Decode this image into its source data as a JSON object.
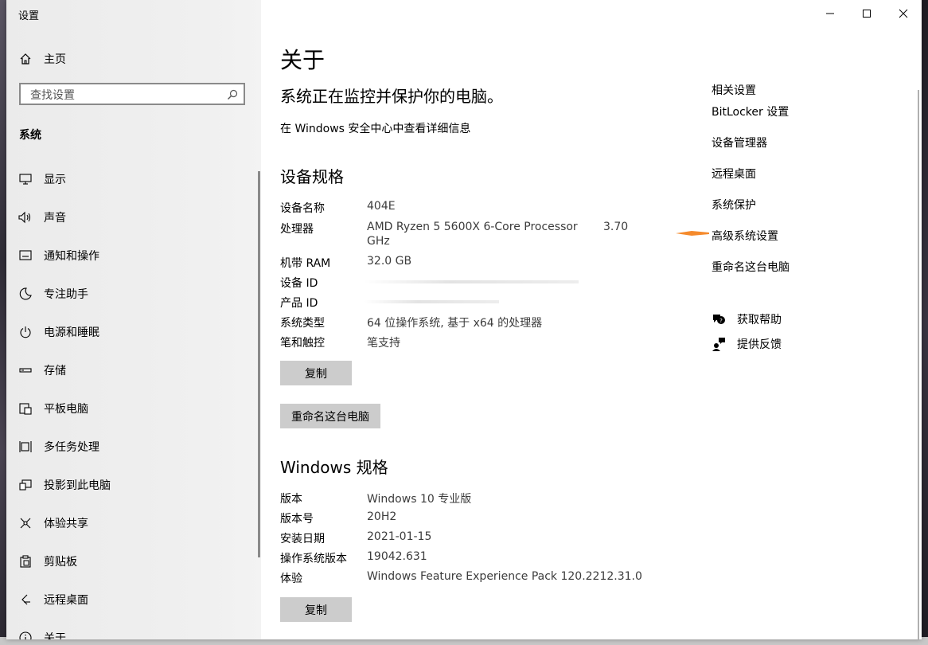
{
  "window": {
    "title": "设置"
  },
  "sidebar": {
    "home_label": "主页",
    "search_placeholder": "查找设置",
    "section_label": "系统",
    "items": [
      {
        "label": "显示",
        "icon": "monitor-icon"
      },
      {
        "label": "声音",
        "icon": "speaker-icon"
      },
      {
        "label": "通知和操作",
        "icon": "notification-icon"
      },
      {
        "label": "专注助手",
        "icon": "moon-icon"
      },
      {
        "label": "电源和睡眠",
        "icon": "power-icon"
      },
      {
        "label": "存储",
        "icon": "storage-icon"
      },
      {
        "label": "平板电脑",
        "icon": "tablet-icon"
      },
      {
        "label": "多任务处理",
        "icon": "multitask-icon"
      },
      {
        "label": "投影到此电脑",
        "icon": "project-icon"
      },
      {
        "label": "体验共享",
        "icon": "share-icon"
      },
      {
        "label": "剪贴板",
        "icon": "clipboard-icon"
      },
      {
        "label": "远程桌面",
        "icon": "remote-desktop-icon"
      },
      {
        "label": "关于",
        "icon": "info-icon"
      }
    ]
  },
  "main": {
    "title": "关于",
    "protection_text": "系统正在监控并保护你的电脑。",
    "security_link": "在 Windows 安全中心中查看详细信息",
    "device_specs": {
      "heading": "设备规格",
      "rows": [
        {
          "key": "设备名称",
          "value": "404E"
        },
        {
          "key": "机带 RAM",
          "value": "32.0 GB"
        },
        {
          "key": "设备 ID",
          "value": ""
        },
        {
          "key": "产品 ID",
          "value": ""
        },
        {
          "key": "系统类型",
          "value": "64 位操作系统, 基于 x64 的处理器"
        },
        {
          "key": "笔和触控",
          "value": "笔支持"
        }
      ],
      "processor": {
        "key": "处理器",
        "value_part1": "AMD Ryzen 5 5600X 6-Core Processor",
        "value_part2": "3.70",
        "value_part3": "GHz"
      },
      "copy_button": "复制",
      "rename_button": "重命名这台电脑"
    },
    "windows_specs": {
      "heading": "Windows 规格",
      "rows": [
        {
          "key": "版本",
          "value": "Windows 10 专业版"
        },
        {
          "key": "版本号",
          "value": "20H2"
        },
        {
          "key": "安装日期",
          "value": "2021-01-15"
        },
        {
          "key": "操作系统版本",
          "value": "19042.631"
        },
        {
          "key": "体验",
          "value": "Windows Feature Experience Pack 120.2212.31.0"
        }
      ],
      "copy_button": "复制"
    }
  },
  "related": {
    "heading": "相关设置",
    "links": [
      "BitLocker 设置",
      "设备管理器",
      "远程桌面",
      "系统保护",
      "高级系统设置",
      "重命名这台电脑"
    ],
    "help": "获取帮助",
    "feedback": "提供反馈"
  },
  "colors": {
    "annotation_arrow": "#f58a2c",
    "button_bg": "#cccccc",
    "sidebar_bg": "#ededed"
  }
}
